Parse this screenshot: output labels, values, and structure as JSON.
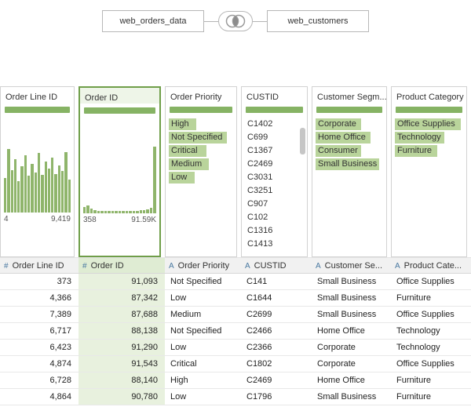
{
  "flow": {
    "left_table": "web_orders_data",
    "right_table": "web_customers"
  },
  "colors": {
    "accent_green": "#86b364",
    "bar_green": "#8fb56b",
    "value_bar_green": "#b9d49b",
    "selected_border_green": "#6f9e49",
    "highlight_cell_green": "#e8f1de",
    "type_icon_blue": "#4a79a1"
  },
  "profile_cards": [
    {
      "title": "Order Line ID",
      "type": "histogram",
      "selected": false,
      "min_label": "4",
      "max_label": "9,419",
      "bars": [
        52,
        95,
        63,
        80,
        47,
        70,
        86,
        55,
        73,
        60,
        89,
        56,
        76,
        66,
        82,
        58,
        71,
        62,
        91,
        50
      ]
    },
    {
      "title": "Order ID",
      "type": "histogram",
      "selected": true,
      "min_label": "358",
      "max_label": "91.59K",
      "bars": [
        9,
        12,
        7,
        5,
        4,
        4,
        4,
        4,
        4,
        4,
        4,
        4,
        4,
        4,
        4,
        4,
        5,
        5,
        6,
        8,
        100
      ]
    },
    {
      "title": "Order Priority",
      "type": "values",
      "selected": false,
      "values": [
        {
          "label": "High",
          "fill": 0.41
        },
        {
          "label": "Not Specified",
          "fill": 0.86
        },
        {
          "label": "Critical",
          "fill": 0.56
        },
        {
          "label": "Medium",
          "fill": 0.59
        },
        {
          "label": "Low",
          "fill": 0.38
        }
      ]
    },
    {
      "title": "CUSTID",
      "type": "list",
      "selected": false,
      "scrollbar": true,
      "values": [
        "C1402",
        "C699",
        "C1367",
        "C2469",
        "C3031",
        "C3251",
        "C907",
        "C102",
        "C1316",
        "C1413"
      ]
    },
    {
      "title": "Customer Segm...",
      "type": "values",
      "selected": false,
      "values": [
        {
          "label": "Corporate",
          "fill": 0.64
        },
        {
          "label": "Home Office",
          "fill": 0.78
        },
        {
          "label": "Consumer",
          "fill": 0.64
        },
        {
          "label": "Small Business",
          "fill": 0.9
        }
      ]
    },
    {
      "title": "Product Category",
      "type": "values",
      "selected": false,
      "values": [
        {
          "label": "Office Supplies",
          "fill": 0.92
        },
        {
          "label": "Technology",
          "fill": 0.69
        },
        {
          "label": "Furniture",
          "fill": 0.59
        }
      ]
    }
  ],
  "grid": {
    "columns": [
      {
        "icon": "#",
        "label": "Order Line ID",
        "align": "right",
        "highlight": false
      },
      {
        "icon": "#",
        "label": "Order ID",
        "align": "right",
        "highlight": true
      },
      {
        "icon": "A",
        "label": "Order Priority",
        "align": "left",
        "highlight": false
      },
      {
        "icon": "A",
        "label": "CUSTID",
        "align": "left",
        "highlight": false
      },
      {
        "icon": "A",
        "label": "Customer Se...",
        "align": "left",
        "highlight": false
      },
      {
        "icon": "A",
        "label": "Product Cate...",
        "align": "left",
        "highlight": false
      }
    ],
    "rows": [
      [
        "373",
        "91,093",
        "Not Specified",
        "C141",
        "Small Business",
        "Office Supplies"
      ],
      [
        "4,366",
        "87,342",
        "Low",
        "C1644",
        "Small Business",
        "Furniture"
      ],
      [
        "7,389",
        "87,688",
        "Medium",
        "C2699",
        "Small Business",
        "Office Supplies"
      ],
      [
        "6,717",
        "88,138",
        "Not Specified",
        "C2466",
        "Home Office",
        "Technology"
      ],
      [
        "6,423",
        "91,290",
        "Low",
        "C2366",
        "Corporate",
        "Technology"
      ],
      [
        "4,874",
        "91,543",
        "Critical",
        "C1802",
        "Corporate",
        "Office Supplies"
      ],
      [
        "6,728",
        "88,140",
        "High",
        "C2469",
        "Home Office",
        "Furniture"
      ],
      [
        "4,864",
        "90,780",
        "Low",
        "C1796",
        "Small Business",
        "Furniture"
      ]
    ]
  }
}
